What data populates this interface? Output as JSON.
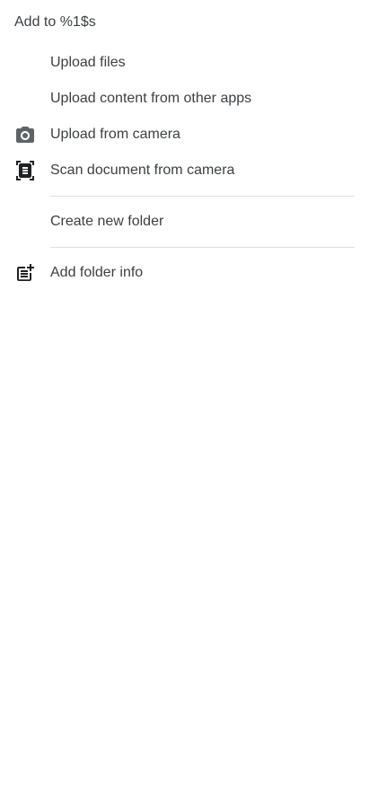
{
  "sheet": {
    "title": "Add to %1$s"
  },
  "menu": {
    "upload_files": {
      "label": "Upload files"
    },
    "upload_content": {
      "label": "Upload content from other apps"
    },
    "upload_camera": {
      "label": "Upload from camera",
      "icon": "camera-icon"
    },
    "scan_document": {
      "label": "Scan document from camera",
      "icon": "document-scanner-icon"
    },
    "create_folder": {
      "label": "Create new folder"
    },
    "add_folder_info": {
      "label": "Add folder info",
      "icon": "post-add-icon"
    }
  },
  "colors": {
    "text": "#3c4043",
    "icon": "#5f6368",
    "divider": "#e0e0e0",
    "background": "#ffffff"
  }
}
